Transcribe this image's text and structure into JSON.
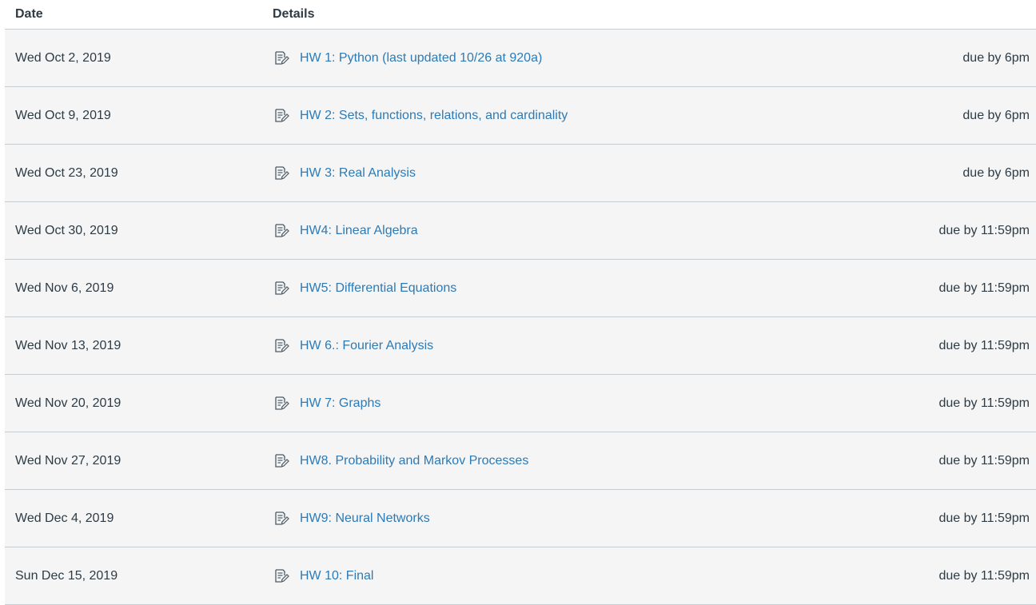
{
  "header": {
    "date_label": "Date",
    "details_label": "Details"
  },
  "colors": {
    "link": "#2d7ab5",
    "row_bg": "#f5f5f5",
    "text": "#2d3b45",
    "divider": "#c7cdd1"
  },
  "icons": {
    "assignment": "assignment-icon"
  },
  "rows": [
    {
      "date": "Wed Oct 2, 2019",
      "title": "HW 1: Python (last updated 10/26 at 920a)",
      "due": "due by 6pm"
    },
    {
      "date": "Wed Oct 9, 2019",
      "title": "HW 2: Sets, functions, relations, and cardinality",
      "due": "due by 6pm"
    },
    {
      "date": "Wed Oct 23, 2019",
      "title": "HW 3: Real Analysis",
      "due": "due by 6pm"
    },
    {
      "date": "Wed Oct 30, 2019",
      "title": "HW4: Linear Algebra",
      "due": "due by 11:59pm"
    },
    {
      "date": "Wed Nov 6, 2019",
      "title": "HW5: Differential Equations",
      "due": "due by 11:59pm"
    },
    {
      "date": "Wed Nov 13, 2019",
      "title": "HW 6.: Fourier Analysis",
      "due": "due by 11:59pm"
    },
    {
      "date": "Wed Nov 20, 2019",
      "title": "HW 7: Graphs",
      "due": "due by 11:59pm"
    },
    {
      "date": "Wed Nov 27, 2019",
      "title": "HW8. Probability and Markov Processes",
      "due": "due by 11:59pm"
    },
    {
      "date": "Wed Dec 4, 2019",
      "title": "HW9: Neural Networks",
      "due": "due by 11:59pm"
    },
    {
      "date": "Sun Dec 15, 2019",
      "title": "HW 10: Final",
      "due": "due by 11:59pm"
    }
  ]
}
